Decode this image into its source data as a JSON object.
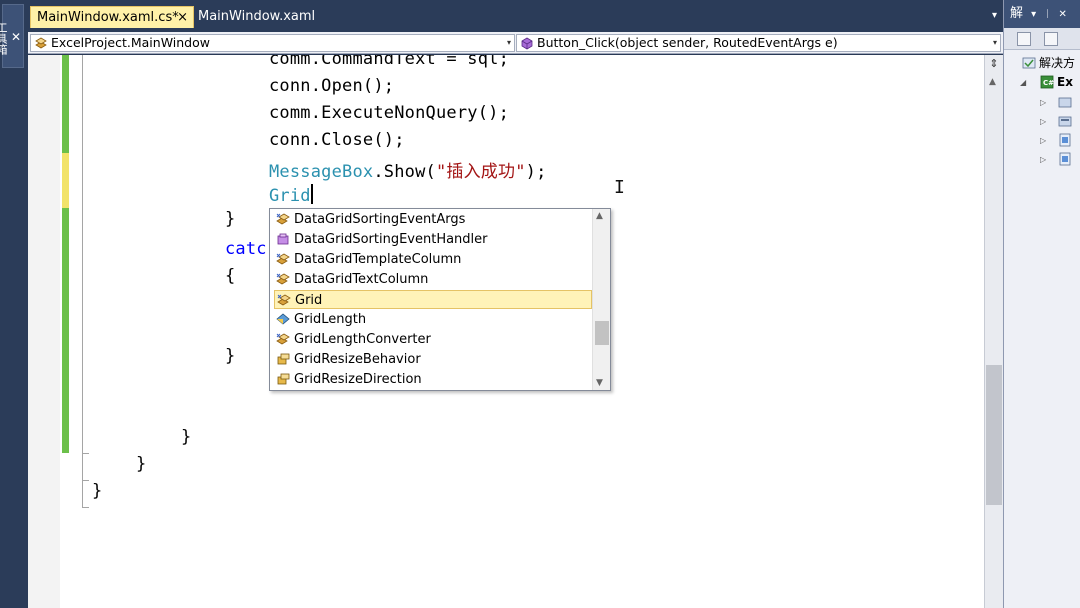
{
  "toolbox": {
    "label": "工具箱",
    "icon": "toolbox-icon"
  },
  "tabs": [
    {
      "label": "MainWindow.xaml.cs*",
      "active": true,
      "close": "×"
    },
    {
      "label": "MainWindow.xaml",
      "active": false
    }
  ],
  "tab_dropdown": "▾",
  "nav": {
    "class_combo": "ExcelProject.MainWindow",
    "member_combo": "Button_Click(object sender, RoutedEventArgs e)",
    "arrow": "▾"
  },
  "code": {
    "l0_a": "comm.CommandText = sql;",
    "l1": "conn.Open();",
    "l2": "comm.ExecuteNonQuery();",
    "l3": "conn.Close();",
    "l4_type": "MessageBox",
    "l4_rest": ".Show(",
    "l4_str": "\"插入成功\"",
    "l4_end": ");",
    "l5": "Grid",
    "l6": "}",
    "l7": "catc",
    "l8": "{",
    "l9": "}",
    "l10": "}",
    "l11": "}",
    "l12": "}"
  },
  "completion": {
    "items": [
      {
        "label": "DataGridSortingEventArgs",
        "icon": "class-icon"
      },
      {
        "label": "DataGridSortingEventHandler",
        "icon": "delegate-icon"
      },
      {
        "label": "DataGridTemplateColumn",
        "icon": "class-icon"
      },
      {
        "label": "DataGridTextColumn",
        "icon": "class-icon"
      },
      {
        "label": "Grid",
        "icon": "class-icon",
        "selected": true
      },
      {
        "label": "GridLength",
        "icon": "struct-icon"
      },
      {
        "label": "GridLengthConverter",
        "icon": "class-icon"
      },
      {
        "label": "GridResizeBehavior",
        "icon": "enum-icon"
      },
      {
        "label": "GridResizeDirection",
        "icon": "enum-icon"
      }
    ],
    "scroll_up": "▲",
    "scroll_down": "▼"
  },
  "editor_scroll": {
    "split": "⇕",
    "up": "▲"
  },
  "right_panel": {
    "title": "解",
    "pin": "▾",
    "pin2": "ᛁ",
    "close": "✕",
    "tree": [
      {
        "label": "解决方",
        "icon": "solution-icon"
      },
      {
        "label": "Ex",
        "icon": "csharp-project-icon"
      }
    ]
  },
  "colors": {
    "frame": "#293955",
    "active_tab": "#fff1a8",
    "change_green": "#6cc04a",
    "change_yellow": "#f2e36a",
    "type": "#2b91af",
    "string": "#a31515",
    "keyword": "#0000ff"
  }
}
